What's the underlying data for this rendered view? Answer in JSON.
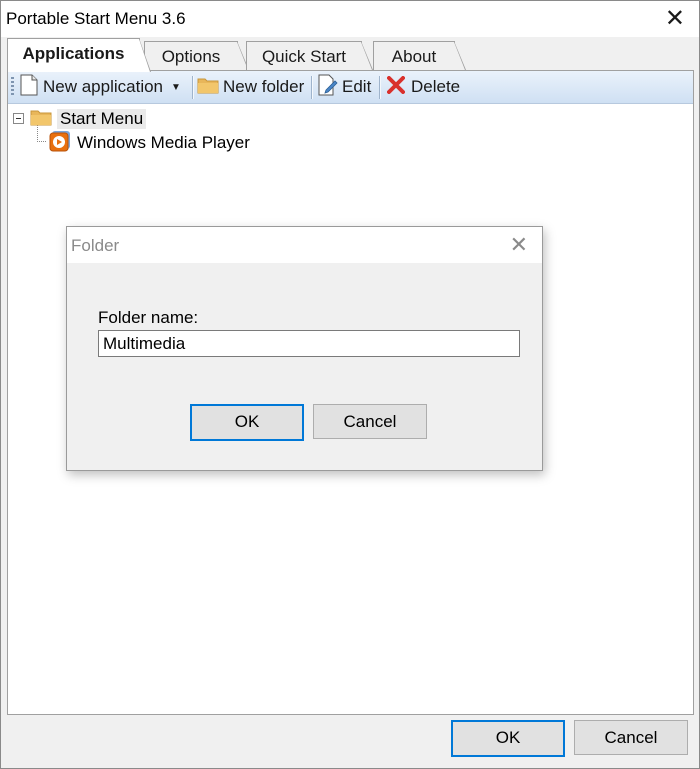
{
  "window": {
    "title": "Portable Start Menu 3.6",
    "close_glyph": "✕"
  },
  "tabs": [
    {
      "label": "Applications",
      "active": true
    },
    {
      "label": "Options",
      "active": false
    },
    {
      "label": "Quick Start",
      "active": false
    },
    {
      "label": "About",
      "active": false
    }
  ],
  "toolbar": {
    "new_application": "New application",
    "dropdown_glyph": "▼",
    "new_folder": "New folder",
    "edit": "Edit",
    "delete": "Delete"
  },
  "tree": {
    "root": "Start Menu",
    "children": [
      "Windows Media Player"
    ]
  },
  "dialog": {
    "title": "Folder",
    "close_glyph": "✕",
    "label": "Folder name:",
    "value": "Multimedia",
    "ok": "OK",
    "cancel": "Cancel"
  },
  "footer": {
    "ok": "OK",
    "cancel": "Cancel"
  },
  "colors": {
    "accent": "#0078d7",
    "folder": "#e8b65a",
    "delete": "#d9302c",
    "toolbar_top": "#eaf2fb",
    "toolbar_bottom": "#cfe0f3",
    "media_orange": "#e8700f"
  }
}
